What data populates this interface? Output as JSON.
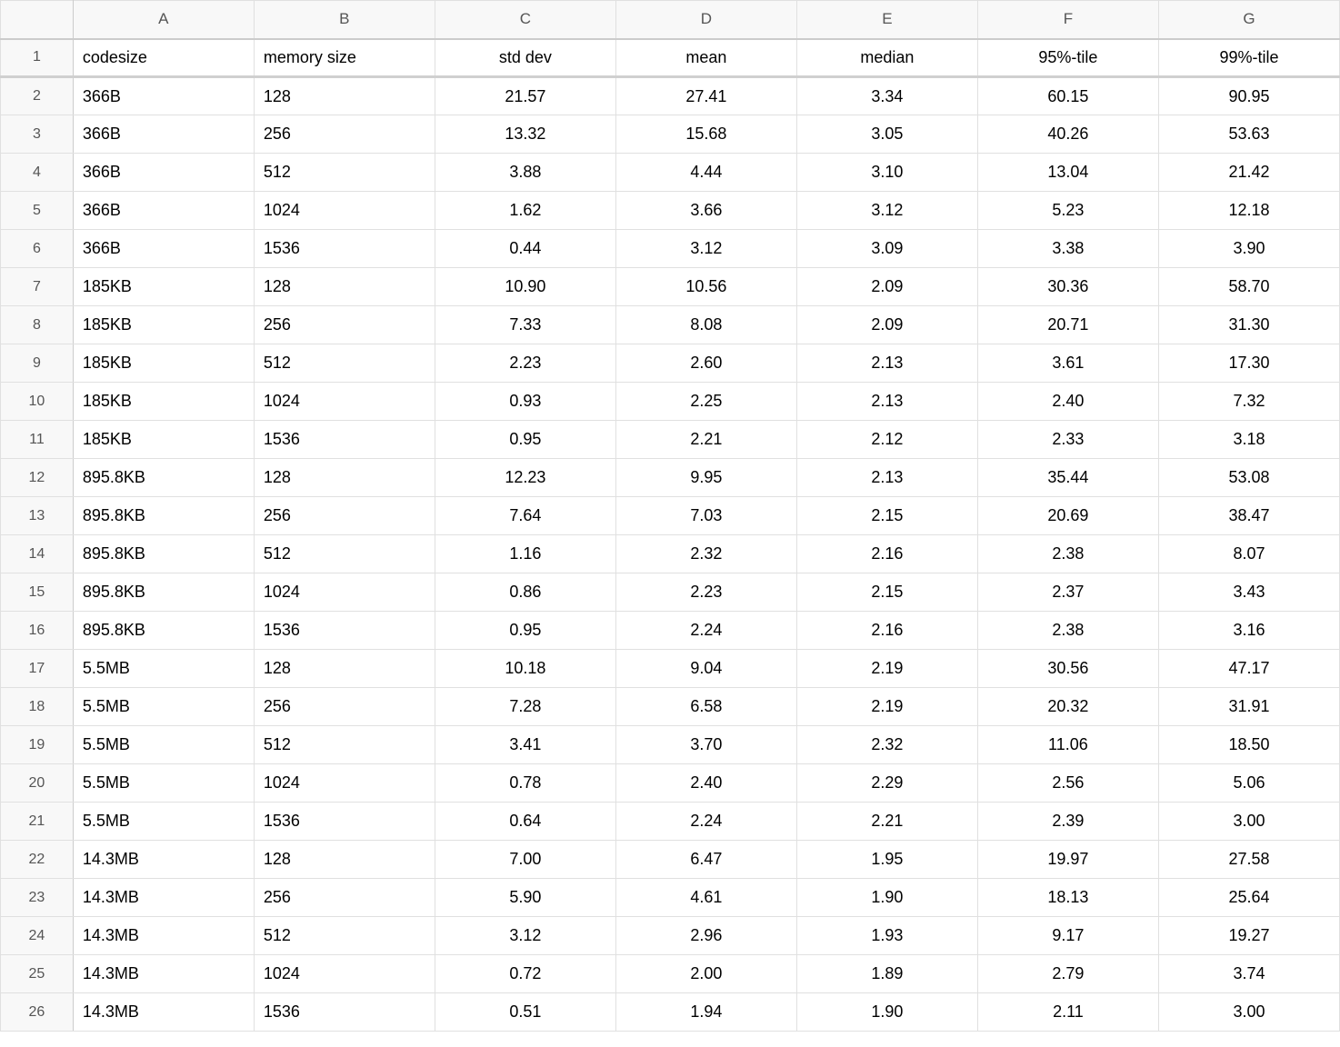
{
  "columns": [
    "A",
    "B",
    "C",
    "D",
    "E",
    "F",
    "G"
  ],
  "rowNumbers": [
    "1",
    "2",
    "3",
    "4",
    "5",
    "6",
    "7",
    "8",
    "9",
    "10",
    "11",
    "12",
    "13",
    "14",
    "15",
    "16",
    "17",
    "18",
    "19",
    "20",
    "21",
    "22",
    "23",
    "24",
    "25",
    "26"
  ],
  "headers": {
    "A": "codesize",
    "B": "memory size",
    "C": "std dev",
    "D": "mean",
    "E": "median",
    "F": "95%-tile",
    "G": "99%-tile"
  },
  "headerAlign": {
    "A": "left",
    "B": "left",
    "C": "center",
    "D": "center",
    "E": "center",
    "F": "center",
    "G": "center"
  },
  "dataAlign": {
    "A": "left",
    "B": "left",
    "C": "center",
    "D": "center",
    "E": "center",
    "F": "center",
    "G": "center"
  },
  "rows": [
    {
      "A": "366B",
      "B": "128",
      "C": "21.57",
      "D": "27.41",
      "E": "3.34",
      "F": "60.15",
      "G": "90.95"
    },
    {
      "A": "366B",
      "B": "256",
      "C": "13.32",
      "D": "15.68",
      "E": "3.05",
      "F": "40.26",
      "G": "53.63"
    },
    {
      "A": "366B",
      "B": "512",
      "C": "3.88",
      "D": "4.44",
      "E": "3.10",
      "F": "13.04",
      "G": "21.42"
    },
    {
      "A": "366B",
      "B": "1024",
      "C": "1.62",
      "D": "3.66",
      "E": "3.12",
      "F": "5.23",
      "G": "12.18"
    },
    {
      "A": "366B",
      "B": "1536",
      "C": "0.44",
      "D": "3.12",
      "E": "3.09",
      "F": "3.38",
      "G": "3.90"
    },
    {
      "A": "185KB",
      "B": "128",
      "C": "10.90",
      "D": "10.56",
      "E": "2.09",
      "F": "30.36",
      "G": "58.70"
    },
    {
      "A": "185KB",
      "B": "256",
      "C": "7.33",
      "D": "8.08",
      "E": "2.09",
      "F": "20.71",
      "G": "31.30"
    },
    {
      "A": "185KB",
      "B": "512",
      "C": "2.23",
      "D": "2.60",
      "E": "2.13",
      "F": "3.61",
      "G": "17.30"
    },
    {
      "A": "185KB",
      "B": "1024",
      "C": "0.93",
      "D": "2.25",
      "E": "2.13",
      "F": "2.40",
      "G": "7.32"
    },
    {
      "A": "185KB",
      "B": "1536",
      "C": "0.95",
      "D": "2.21",
      "E": "2.12",
      "F": "2.33",
      "G": "3.18"
    },
    {
      "A": "895.8KB",
      "B": "128",
      "C": "12.23",
      "D": "9.95",
      "E": "2.13",
      "F": "35.44",
      "G": "53.08"
    },
    {
      "A": "895.8KB",
      "B": "256",
      "C": "7.64",
      "D": "7.03",
      "E": "2.15",
      "F": "20.69",
      "G": "38.47"
    },
    {
      "A": "895.8KB",
      "B": "512",
      "C": "1.16",
      "D": "2.32",
      "E": "2.16",
      "F": "2.38",
      "G": "8.07"
    },
    {
      "A": "895.8KB",
      "B": "1024",
      "C": "0.86",
      "D": "2.23",
      "E": "2.15",
      "F": "2.37",
      "G": "3.43"
    },
    {
      "A": "895.8KB",
      "B": "1536",
      "C": "0.95",
      "D": "2.24",
      "E": "2.16",
      "F": "2.38",
      "G": "3.16"
    },
    {
      "A": "5.5MB",
      "B": "128",
      "C": "10.18",
      "D": "9.04",
      "E": "2.19",
      "F": "30.56",
      "G": "47.17"
    },
    {
      "A": "5.5MB",
      "B": "256",
      "C": "7.28",
      "D": "6.58",
      "E": "2.19",
      "F": "20.32",
      "G": "31.91"
    },
    {
      "A": "5.5MB",
      "B": "512",
      "C": "3.41",
      "D": "3.70",
      "E": "2.32",
      "F": "11.06",
      "G": "18.50"
    },
    {
      "A": "5.5MB",
      "B": "1024",
      "C": "0.78",
      "D": "2.40",
      "E": "2.29",
      "F": "2.56",
      "G": "5.06"
    },
    {
      "A": "5.5MB",
      "B": "1536",
      "C": "0.64",
      "D": "2.24",
      "E": "2.21",
      "F": "2.39",
      "G": "3.00"
    },
    {
      "A": "14.3MB",
      "B": "128",
      "C": "7.00",
      "D": "6.47",
      "E": "1.95",
      "F": "19.97",
      "G": "27.58"
    },
    {
      "A": "14.3MB",
      "B": "256",
      "C": "5.90",
      "D": "4.61",
      "E": "1.90",
      "F": "18.13",
      "G": "25.64"
    },
    {
      "A": "14.3MB",
      "B": "512",
      "C": "3.12",
      "D": "2.96",
      "E": "1.93",
      "F": "9.17",
      "G": "19.27"
    },
    {
      "A": "14.3MB",
      "B": "1024",
      "C": "0.72",
      "D": "2.00",
      "E": "1.89",
      "F": "2.79",
      "G": "3.74"
    },
    {
      "A": "14.3MB",
      "B": "1536",
      "C": "0.51",
      "D": "1.94",
      "E": "1.90",
      "F": "2.11",
      "G": "3.00"
    }
  ]
}
